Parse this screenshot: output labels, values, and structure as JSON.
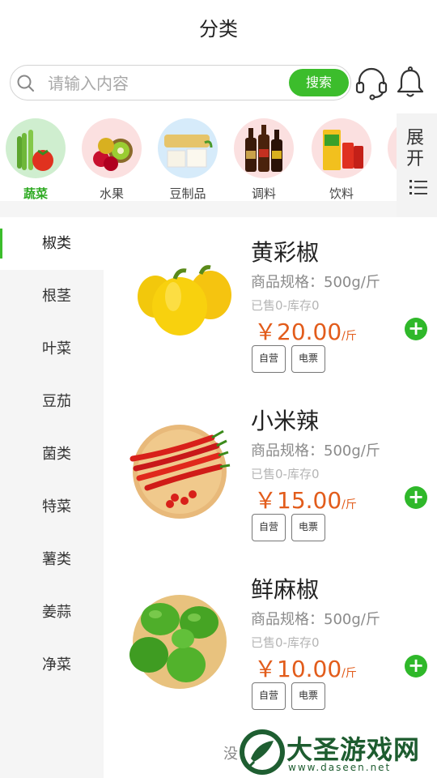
{
  "header": {
    "title": "分类"
  },
  "search": {
    "placeholder": "请输入内容",
    "button_label": "搜索"
  },
  "header_icons": {
    "service": "headset-icon",
    "notify": "bell-icon"
  },
  "categories": [
    {
      "label": "蔬菜",
      "active": true
    },
    {
      "label": "水果",
      "active": false
    },
    {
      "label": "豆制品",
      "active": false
    },
    {
      "label": "调料",
      "active": false
    },
    {
      "label": "饮料",
      "active": false
    }
  ],
  "expand": {
    "label_line1": "展",
    "label_line2": "开"
  },
  "sidebar": {
    "items": [
      {
        "label": "椒类",
        "active": true
      },
      {
        "label": "根茎"
      },
      {
        "label": "叶菜"
      },
      {
        "label": "豆茄"
      },
      {
        "label": "菌类"
      },
      {
        "label": "特菜"
      },
      {
        "label": "薯类"
      },
      {
        "label": "姜蒜"
      },
      {
        "label": "净菜"
      }
    ]
  },
  "products": [
    {
      "name": "黄彩椒",
      "spec": "商品规格：500g/斤",
      "sold": "已售0-库存0",
      "price": "￥20.00",
      "unit": "/斤",
      "tags": [
        "自营",
        "电票"
      ]
    },
    {
      "name": "小米辣",
      "spec": "商品规格：500g/斤",
      "sold": "已售0-库存0",
      "price": "￥15.00",
      "unit": "/斤",
      "tags": [
        "自营",
        "电票"
      ]
    },
    {
      "name": "鲜麻椒",
      "spec": "商品规格：500g/斤",
      "sold": "已售0-库存0",
      "price": "￥10.00",
      "unit": "/斤",
      "tags": [
        "自营",
        "电票"
      ]
    }
  ],
  "add_symbol": "+",
  "footer_text": "没",
  "watermark": {
    "name": "大圣游戏网",
    "url": "www.daseen.net"
  },
  "colors": {
    "accent": "#3cbd2c",
    "price": "#e25c1b"
  }
}
